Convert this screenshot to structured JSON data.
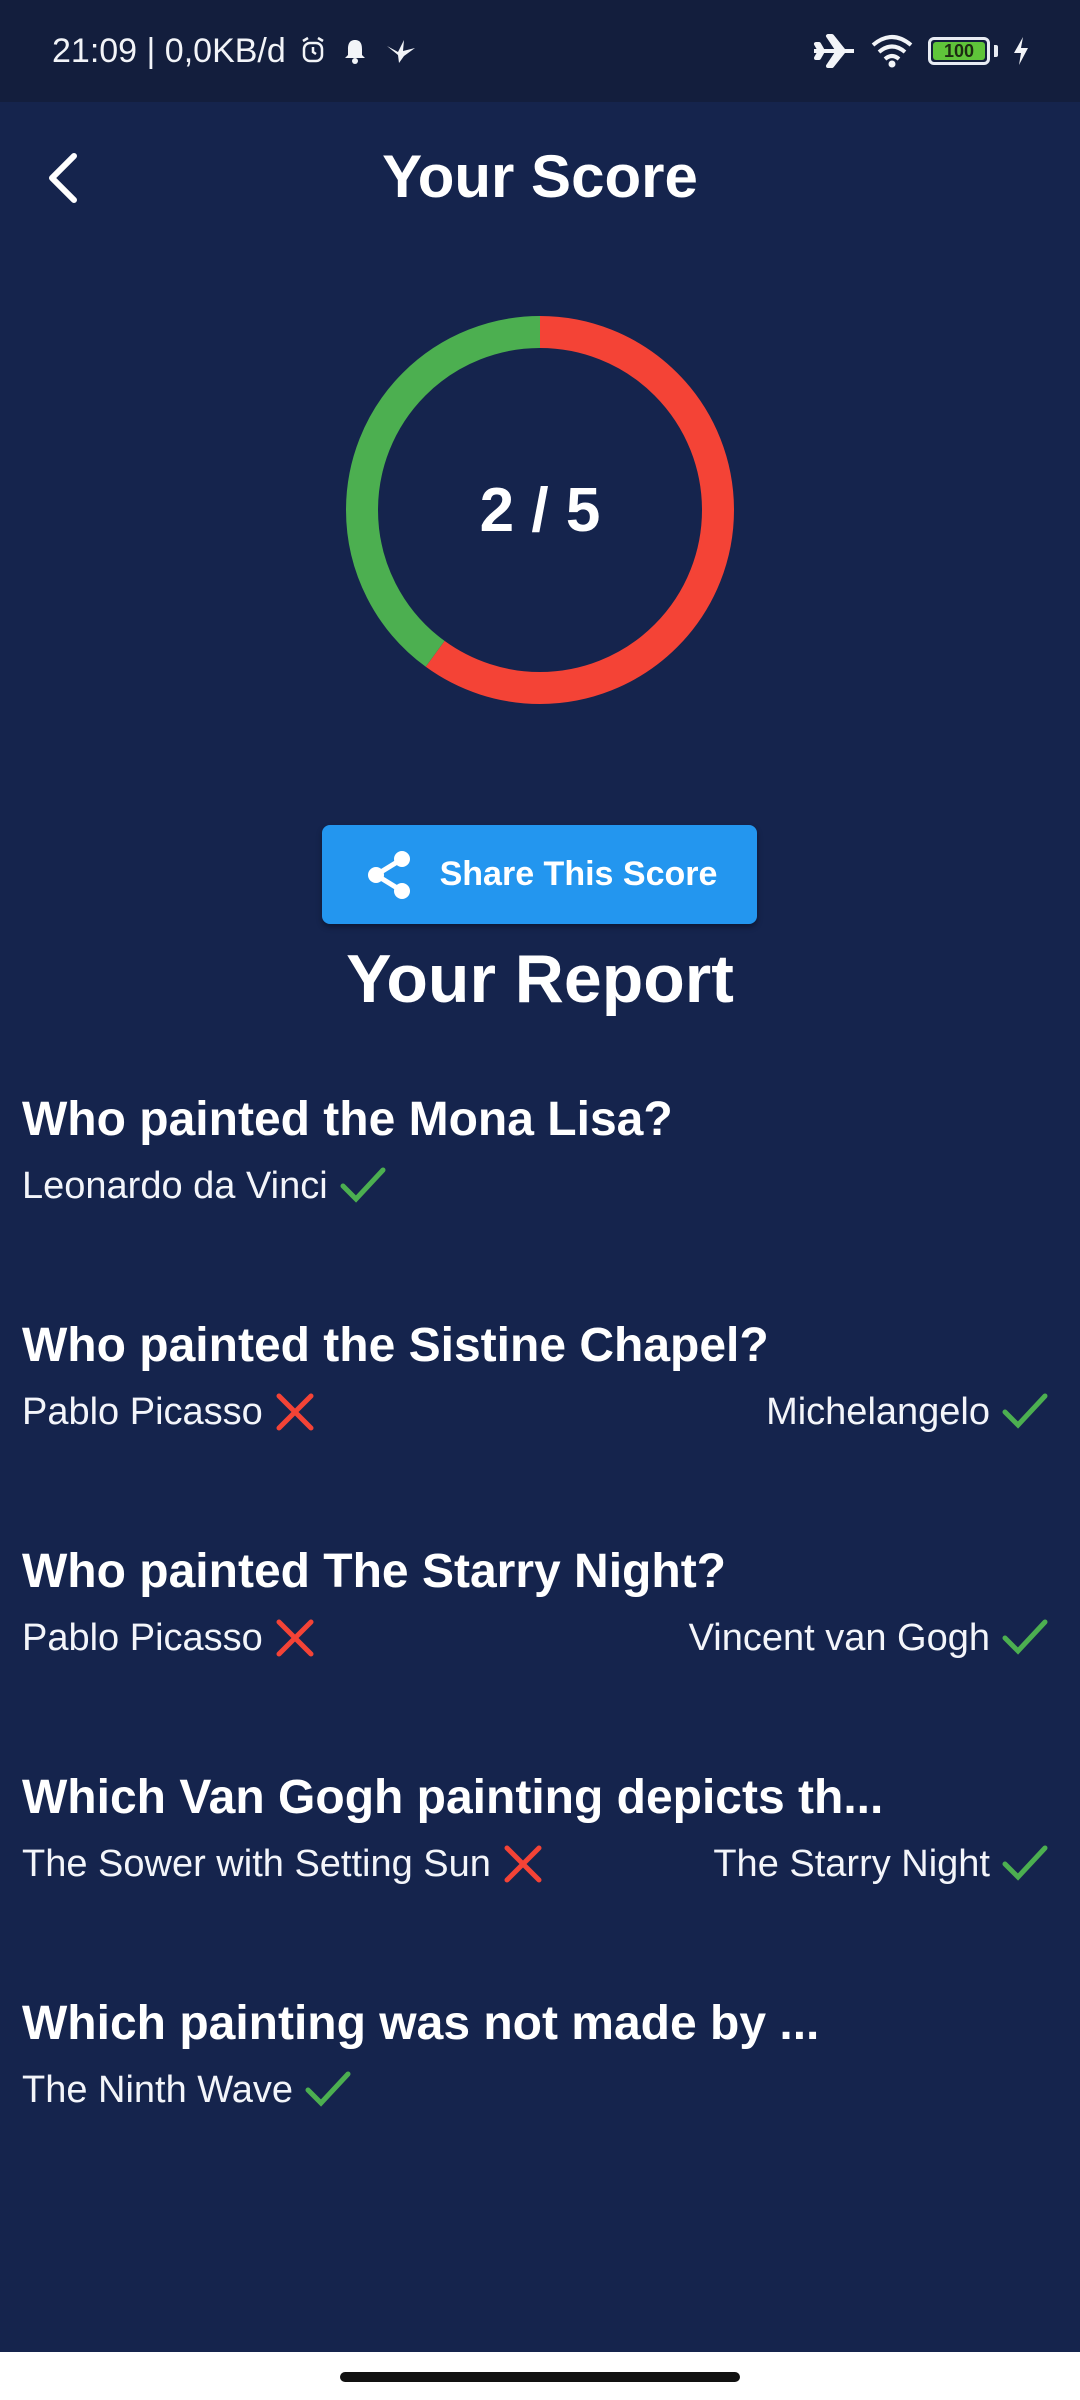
{
  "status_bar": {
    "time_and_speed": "21:09 | 0,0KB/d",
    "battery_level": "100",
    "icons": [
      "alarm-icon",
      "bell-icon",
      "bird-icon",
      "airplane-icon",
      "wifi-icon",
      "battery-icon",
      "charging-icon"
    ]
  },
  "header": {
    "title": "Your Score",
    "back_icon": "chevron-left-icon"
  },
  "score": {
    "text": "2 / 5",
    "correct": 2,
    "total": 5,
    "ring_colors": {
      "correct": "#4caf50",
      "incorrect": "#f44336"
    }
  },
  "share_button": {
    "label": "Share This Score",
    "icon": "share-icon",
    "color": "#2196f3"
  },
  "report": {
    "title": "Your Report",
    "items": [
      {
        "question": "Who painted the Mona Lisa?",
        "answers": [
          {
            "text": "Leonardo da Vinci",
            "correct": true
          }
        ]
      },
      {
        "question": "Who painted the Sistine Chapel?",
        "answers": [
          {
            "text": "Pablo Picasso",
            "correct": false
          },
          {
            "text": "Michelangelo",
            "correct": true
          }
        ]
      },
      {
        "question": "Who painted The Starry Night?",
        "answers": [
          {
            "text": "Pablo Picasso",
            "correct": false
          },
          {
            "text": "Vincent van Gogh",
            "correct": true
          }
        ]
      },
      {
        "question": "Which Van Gogh painting depicts th...",
        "answers": [
          {
            "text": "The Sower with Setting Sun",
            "correct": false
          },
          {
            "text": "The Starry Night",
            "correct": true
          }
        ]
      },
      {
        "question": "Which painting was not made by ...",
        "answers": [
          {
            "text": "The Ninth Wave",
            "correct": true
          }
        ]
      }
    ]
  }
}
